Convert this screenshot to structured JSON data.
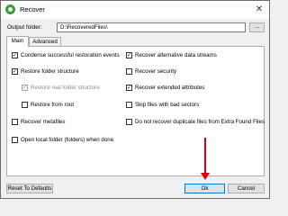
{
  "window": {
    "title": "Recover"
  },
  "output": {
    "label": "Output folder:",
    "value": "D:\\RecoveredFiles\\",
    "browse_label": "..."
  },
  "tabs": [
    {
      "label": "Main"
    },
    {
      "label": "Advanced"
    }
  ],
  "options": {
    "left": [
      {
        "label": "Condense successful restoration events",
        "checked": true,
        "disabled": false
      },
      {
        "label": "Restore folder structure",
        "checked": true,
        "disabled": false
      },
      {
        "label": "Restore real folder structure",
        "checked": true,
        "disabled": true
      },
      {
        "label": "Restore from root",
        "checked": false,
        "disabled": false
      },
      {
        "label": "Recover metafiles",
        "checked": false,
        "disabled": false
      },
      {
        "label": "Open local folder (folders) when done",
        "checked": false,
        "disabled": false
      }
    ],
    "right": [
      {
        "label": "Recover alternative data streams",
        "checked": true,
        "disabled": false
      },
      {
        "label": "Recover security",
        "checked": false,
        "disabled": false
      },
      {
        "label": "Recover extended attributes",
        "checked": true,
        "disabled": false
      },
      {
        "label": "Skip files with bad sectors",
        "checked": false,
        "disabled": false
      },
      {
        "label": "Do not recover duplicate files from Extra Found Files",
        "checked": false,
        "disabled": false
      }
    ]
  },
  "buttons": {
    "reset": "Reset To Defaults",
    "ok": "Ok",
    "cancel": "Cancel"
  },
  "colors": {
    "accent": "#0078d7",
    "arrow": "#e00000",
    "icon": "#3c9a3c"
  }
}
